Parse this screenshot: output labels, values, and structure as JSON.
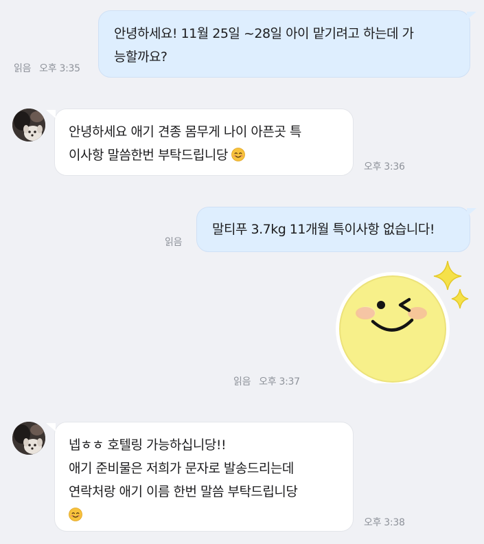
{
  "messages": [
    {
      "id": 1,
      "direction": "outgoing",
      "lines": [
        "안녕하세요! 11월 25일 ~28일 아이 맡기려고 하는데 가",
        "능할까요?"
      ],
      "read_label": "읽음",
      "time": "오후 3:35"
    },
    {
      "id": 2,
      "direction": "incoming",
      "lines": [
        "안녕하세요 애기 견종 몸무게 나이 아픈곳 특",
        "이사항 말씀한번 부탁드립니당"
      ],
      "trailing_emoji": "smiling-face-emoji",
      "time": "오후 3:36"
    },
    {
      "id": 3,
      "direction": "outgoing",
      "lines": [
        "말티푸 3.7kg 11개월 특이사항 없습니다!"
      ],
      "read_label": "읽음"
    },
    {
      "id": 4,
      "direction": "outgoing",
      "type": "sticker",
      "sticker": "winking-smiley-sticker",
      "read_label": "읽음",
      "time": "오후 3:37"
    },
    {
      "id": 5,
      "direction": "incoming",
      "lines": [
        "넵ㅎㅎ 호텔링 가능하십니당!!",
        "애기 준비물은 저희가 문자로 발송드리는데",
        "연락처랑 애기 이름 한번 말씀 부탁드립니당"
      ],
      "trailing_emoji": "smiling-face-emoji",
      "time": "오후 3:38"
    }
  ],
  "colors": {
    "background": "#f0f1f5",
    "outgoing_bubble": "#deeefe",
    "incoming_bubble": "#ffffff",
    "meta_text": "#8e929a",
    "sticker_face": "#f7f08a",
    "sparkle": "#f5e14a"
  }
}
